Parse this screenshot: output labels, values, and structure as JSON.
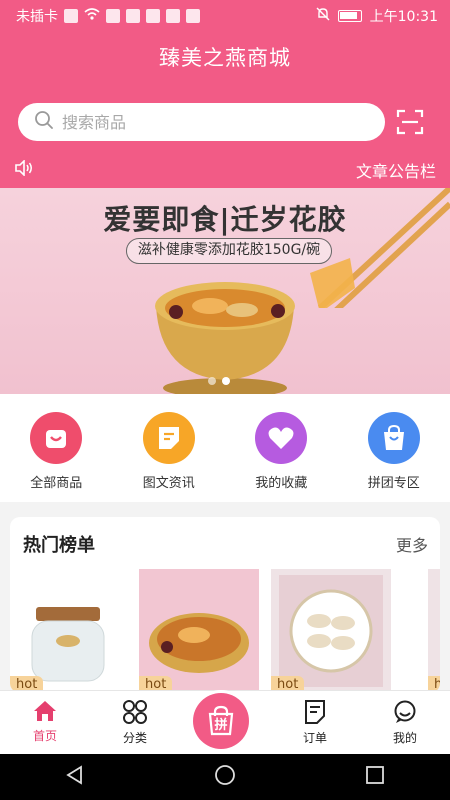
{
  "status_bar": {
    "carrier": "未插卡",
    "time": "上午10:31"
  },
  "header": {
    "title": "臻美之燕商城",
    "search_placeholder": "搜索商品",
    "notice_label": "文章公告栏"
  },
  "banner": {
    "title": "爱要即食|迁岁花胶",
    "subtitle": "滋补健康零添加花胶150G/碗",
    "slide_count": 2,
    "active_slide": 1
  },
  "shortcuts": [
    {
      "label": "全部商品",
      "icon": "bag-icon",
      "color": "#ef4d6c"
    },
    {
      "label": "图文资讯",
      "icon": "document-icon",
      "color": "#f7a627"
    },
    {
      "label": "我的收藏",
      "icon": "heart-icon",
      "color": "#b65be0"
    },
    {
      "label": "拼团专区",
      "icon": "shopping-bag-icon",
      "color": "#4a8bf0"
    }
  ],
  "ranking": {
    "title": "热门榜单",
    "more": "更多",
    "items": [
      {
        "badge": "hot",
        "image": "bird-nest-jar-image"
      },
      {
        "badge": "hot",
        "image": "fish-maw-bowl-image"
      },
      {
        "badge": "hot",
        "image": "bird-nest-gift-box-image"
      },
      {
        "badge": "hot",
        "image": "product-image"
      }
    ]
  },
  "tabbar": {
    "items": [
      {
        "label": "首页",
        "icon": "home-icon",
        "active": true
      },
      {
        "label": "分类",
        "icon": "grid-icon",
        "active": false
      },
      {
        "label": "拼",
        "icon": "group-buy-icon",
        "active": false
      },
      {
        "label": "订单",
        "icon": "order-icon",
        "active": false
      },
      {
        "label": "我的",
        "icon": "profile-icon",
        "active": false
      }
    ]
  },
  "colors": {
    "brand": "#f25b86",
    "active_tab": "#e53f6e"
  }
}
